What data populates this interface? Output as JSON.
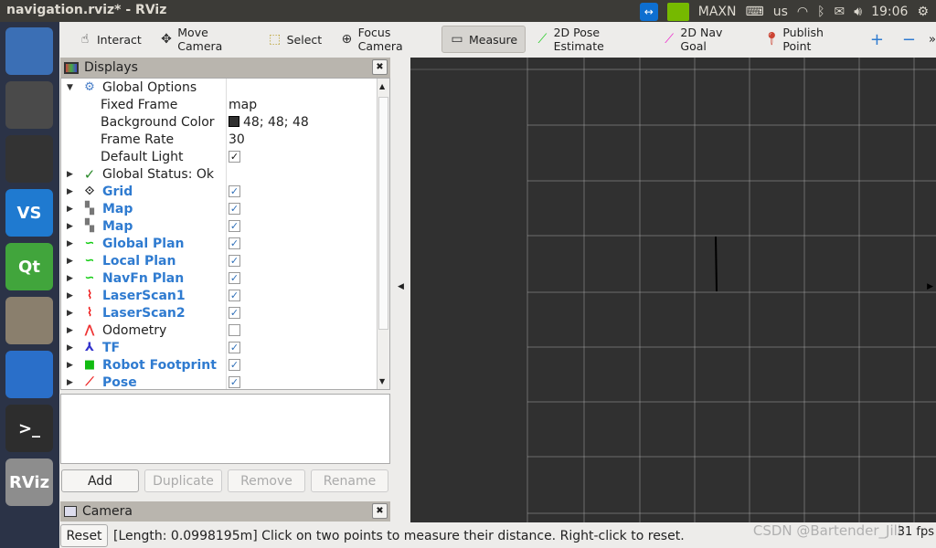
{
  "window": {
    "title": "navigation.rviz* - RViz"
  },
  "tray": {
    "teamviewer": "teamviewer-icon",
    "power_mode": "MAXN",
    "keyboard": "us",
    "time": "19:06"
  },
  "launcher": [
    {
      "name": "ubuntu-dash",
      "color": "#3b6fb5"
    },
    {
      "name": "camera-app",
      "color": "#4a4a4a"
    },
    {
      "name": "qq",
      "color": "#333"
    },
    {
      "name": "vscode",
      "color": "#1f7ad0",
      "label": "VS"
    },
    {
      "name": "qt-creator",
      "color": "#41a53c",
      "label": "Qt"
    },
    {
      "name": "files",
      "color": "#8a7f6d"
    },
    {
      "name": "chromium",
      "color": "#2a6fc9"
    },
    {
      "name": "terminal",
      "color": "#2d2d2d",
      "label": ">_"
    },
    {
      "name": "rviz",
      "color": "#8d8d8d",
      "label": "RViz"
    }
  ],
  "toolbar": [
    {
      "label": "Interact",
      "icon": "hand-icon"
    },
    {
      "label": "Move Camera",
      "icon": "move-camera-icon"
    },
    {
      "label": "Select",
      "icon": "select-icon"
    },
    {
      "label": "Focus Camera",
      "icon": "focus-camera-icon"
    },
    {
      "label": "Measure",
      "icon": "ruler-icon",
      "active": true
    },
    {
      "label": "2D Pose Estimate",
      "icon": "green-arrow-icon"
    },
    {
      "label": "2D Nav Goal",
      "icon": "pink-arrow-icon"
    },
    {
      "label": "Publish Point",
      "icon": "map-pin-icon"
    }
  ],
  "displays": {
    "title": "Displays",
    "global_options": "Global Options",
    "props": [
      {
        "label": "Fixed Frame",
        "value": "map"
      },
      {
        "label": "Background Color",
        "value": "48; 48; 48",
        "swatch": "#303030"
      },
      {
        "label": "Frame Rate",
        "value": "30"
      },
      {
        "label": "Default Light",
        "checked": true
      }
    ],
    "global_status": "Global Status: Ok",
    "items": [
      {
        "label": "Grid",
        "icon": "grid-icon",
        "checked": true
      },
      {
        "label": "Map",
        "icon": "map-icon",
        "checked": true
      },
      {
        "label": "Map",
        "icon": "map-icon",
        "checked": true
      },
      {
        "label": "Global Plan",
        "icon": "path-icon",
        "checked": true
      },
      {
        "label": "Local Plan",
        "icon": "path-icon",
        "checked": true
      },
      {
        "label": "NavFn Plan",
        "icon": "path-icon",
        "checked": true
      },
      {
        "label": "LaserScan1",
        "icon": "laserscan-icon",
        "checked": true
      },
      {
        "label": "LaserScan2",
        "icon": "laserscan-icon",
        "checked": true
      },
      {
        "label": "Odometry",
        "icon": "odometry-icon",
        "checked": false,
        "disabled": true
      },
      {
        "label": "TF",
        "icon": "tf-icon",
        "checked": true
      },
      {
        "label": "Robot Footprint",
        "icon": "polygon-icon",
        "checked": true
      },
      {
        "label": "Pose",
        "icon": "pose-icon",
        "checked": true
      }
    ]
  },
  "buttons": {
    "add": "Add",
    "duplicate": "Duplicate",
    "remove": "Remove",
    "rename": "Rename"
  },
  "camera": {
    "title": "Camera"
  },
  "status": {
    "reset": "Reset",
    "message": "[Length: 0.0998195m] Click on two points to measure their distance. Right-click to reset.",
    "fps": "31 fps"
  },
  "watermark": "CSDN @Bartender_Jill",
  "view": {
    "background": "#303030",
    "grid_color": "#a0a0a0"
  }
}
